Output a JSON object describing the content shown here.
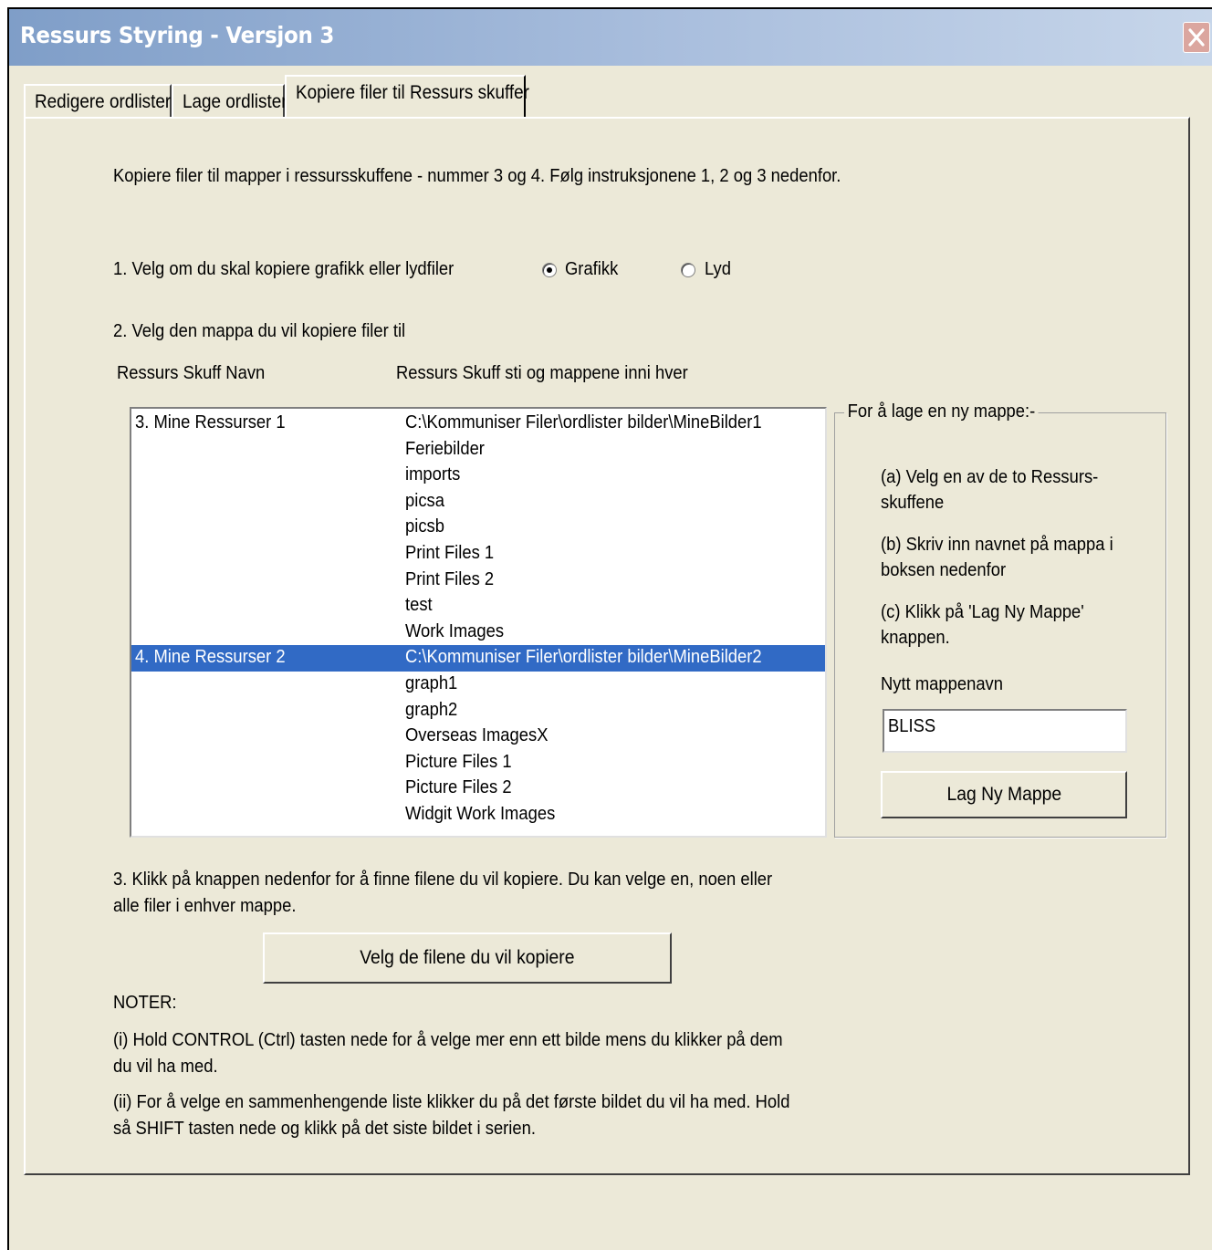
{
  "window": {
    "title": "Ressurs Styring - Versjon 3"
  },
  "tabs": [
    {
      "label": "Redigere ordlister"
    },
    {
      "label": "Lage ordlister"
    },
    {
      "label": "Kopiere filer til Ressurs skuffer",
      "active": true
    }
  ],
  "main": {
    "intro": "Kopiere filer til mapper i ressursskuffene - nummer 3 og 4.  Følg instruksjonene 1, 2 og 3 nedenfor.",
    "step1": "1. Velg om du skal kopiere grafikk eller lydfiler",
    "radio_grafikk": "Grafikk",
    "radio_lyd": "Lyd",
    "selected_radio": "Grafikk",
    "step2": "2. Velg den mappa du vil kopiere filer til",
    "col_name": "Ressurs Skuff Navn",
    "col_path": "Ressurs Skuff sti og mappene inni hver",
    "list_rows": [
      {
        "name": "3. Mine Ressurser 1",
        "path": "C:\\Kommuniser Filer\\ordlister bilder\\MineBilder1"
      },
      {
        "name": "",
        "path": "Feriebilder"
      },
      {
        "name": "",
        "path": "imports"
      },
      {
        "name": "",
        "path": "picsa"
      },
      {
        "name": "",
        "path": "picsb"
      },
      {
        "name": "",
        "path": "Print Files 1"
      },
      {
        "name": "",
        "path": "Print Files 2"
      },
      {
        "name": "",
        "path": "test"
      },
      {
        "name": "",
        "path": "Work Images"
      },
      {
        "name": "4. Mine Ressurser 2",
        "path": "C:\\Kommuniser Filer\\ordlister bilder\\MineBilder2",
        "selected": true
      },
      {
        "name": "",
        "path": "graph1"
      },
      {
        "name": "",
        "path": "graph2"
      },
      {
        "name": "",
        "path": "Overseas ImagesX"
      },
      {
        "name": "",
        "path": "Picture Files 1"
      },
      {
        "name": "",
        "path": "Picture Files 2"
      },
      {
        "name": "",
        "path": "Widgit Work Images"
      }
    ],
    "step3": "3. Klikk på knappen nedenfor for å finne filene du vil kopiere. Du kan velge en, noen eller alle filer i enhver mappe.",
    "choose_files_button": "Velg de filene du vil kopiere",
    "notes_heading": "NOTER:",
    "note1": "(i) Hold CONTROL (Ctrl) tasten nede for å velge mer enn ett bilde mens du klikker på dem du vil ha med.",
    "note2": "(ii) For å velge en sammenhengende liste klikker du på det første bildet du vil ha med. Hold så SHIFT tasten nede og klikk på det siste bildet i serien."
  },
  "new_folder": {
    "group_title": "For å lage en ny mappe:-",
    "step_a": "(a) Velg en av de to Ressurs-skuffene",
    "step_b": "(b) Skriv inn navnet på mappa i boksen nedenfor",
    "step_c": "(c) Klikk på 'Lag Ny Mappe' knappen.",
    "input_label": "Nytt mappenavn",
    "input_value": "BLISS",
    "create_button": "Lag Ny Mappe"
  },
  "colors": {
    "titlebar_start": "#7f9ec8",
    "titlebar_end": "#c7d6ea",
    "face": "#ece9d8",
    "selection": "#316ac5",
    "close_button": "#dba69f"
  }
}
